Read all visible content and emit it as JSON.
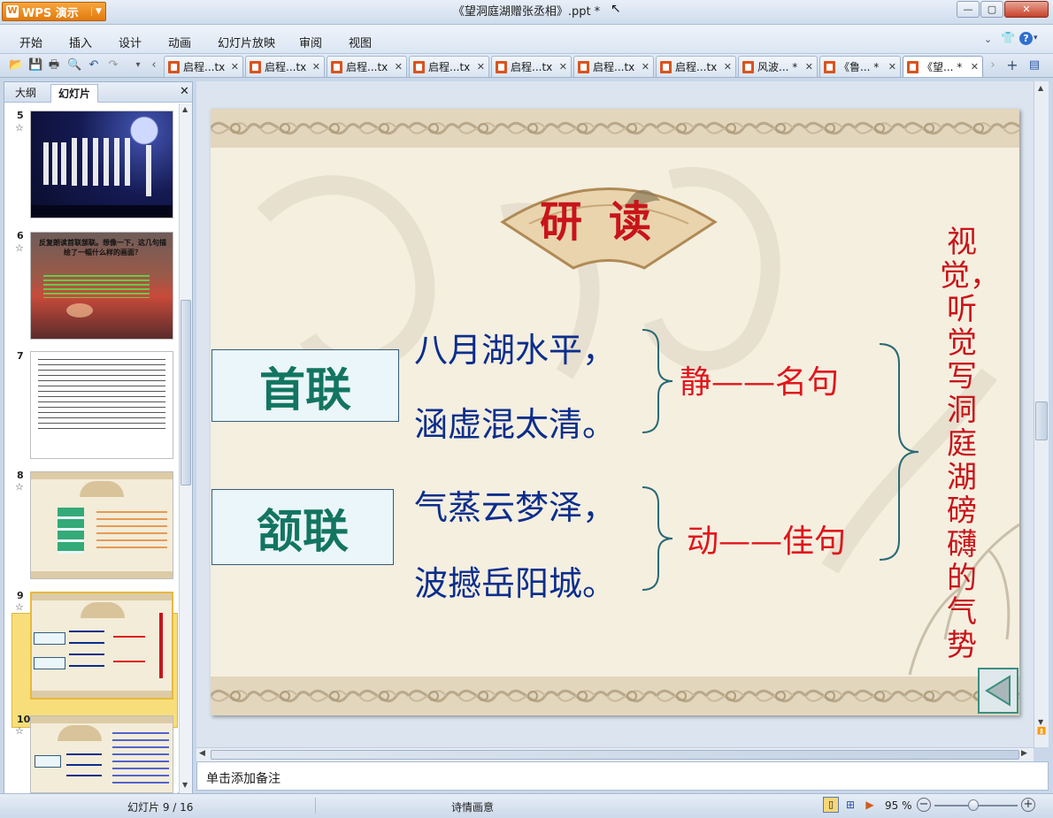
{
  "app": {
    "logo_text": "WPS 演示",
    "window_title": "《望洞庭湖赠张丞相》.ppt *"
  },
  "menu": [
    "开始",
    "插入",
    "设计",
    "动画",
    "幻灯片放映",
    "审阅",
    "视图"
  ],
  "doc_tabs": [
    {
      "label": "启程...tx",
      "active": false
    },
    {
      "label": "启程...tx",
      "active": false
    },
    {
      "label": "启程...tx",
      "active": false
    },
    {
      "label": "启程...tx",
      "active": false
    },
    {
      "label": "启程...tx",
      "active": false
    },
    {
      "label": "启程...tx",
      "active": false
    },
    {
      "label": "启程...tx",
      "active": false
    },
    {
      "label": "风波... *",
      "active": false
    },
    {
      "label": "《鲁... *",
      "active": false
    },
    {
      "label": "《望... *",
      "active": true
    }
  ],
  "left_panel": {
    "tabs": [
      "大纲",
      "幻灯片"
    ],
    "active_tab": "幻灯片",
    "thumbnails": [
      {
        "number": "5"
      },
      {
        "number": "6",
        "title": "反复朗读首联颔联。想像一下，这几句描绘了一幅什么样的画面？"
      },
      {
        "number": "7"
      },
      {
        "number": "8"
      },
      {
        "number": "9",
        "selected": true
      },
      {
        "number": "10"
      }
    ]
  },
  "slide": {
    "heading": "研读",
    "label_1": "首联",
    "label_2": "颔联",
    "line_1": "八月湖水平，",
    "line_2": "涵虚混太清。",
    "line_3": "气蒸云梦泽，",
    "line_4": "波撼岳阳城。",
    "note_1": "静——名句",
    "note_2": "动——佳句",
    "vertical_text": "视觉，听觉写洞庭湖磅礴的气势"
  },
  "notes_placeholder": "单击添加备注",
  "status": {
    "slide_counter": "幻灯片 9 / 16",
    "theme": "诗情画意",
    "zoom": "95 %"
  },
  "colors": {
    "title_red": "#c8141a",
    "poem_blue": "#0b2e8c",
    "label_green": "#137561",
    "note_red": "#e0161b"
  }
}
